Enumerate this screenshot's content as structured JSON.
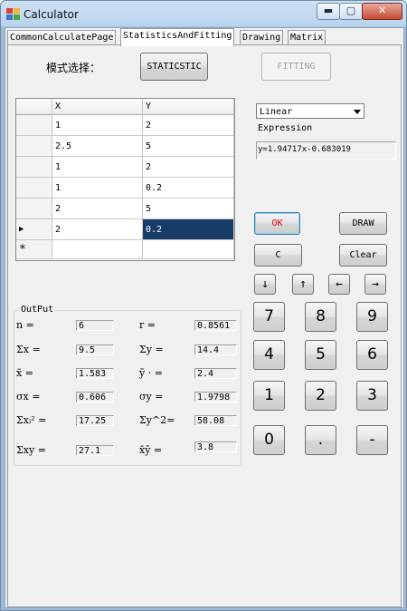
{
  "window": {
    "title": "Calculator",
    "min_glyph": "▬",
    "max_glyph": "▢",
    "close_glyph": "✕"
  },
  "tabs": [
    "CommonCalculatePage",
    "StatisticsAndFitting",
    "Drawing",
    "Matrix"
  ],
  "mode": {
    "label": "模式选择：",
    "statistic_button": "STATICSTIC",
    "fitting_button": "FITTING"
  },
  "grid": {
    "columns": [
      "X",
      "Y"
    ],
    "rows": [
      {
        "x": "1",
        "y": "2"
      },
      {
        "x": "2.5",
        "y": "5"
      },
      {
        "x": "1",
        "y": "2"
      },
      {
        "x": "1",
        "y": "0.2"
      },
      {
        "x": "2",
        "y": "5"
      },
      {
        "x": "2",
        "y": "0.2"
      }
    ],
    "current_marker": "▶",
    "new_row_marker": "*"
  },
  "fit": {
    "type": "Linear",
    "expression_label": "Expression",
    "expression": "y=1.94717x-0.683019"
  },
  "output": {
    "title": "OutPut",
    "left": [
      {
        "label": "n   =",
        "value": "6"
      },
      {
        "label": "Σx  =",
        "value": "9.5"
      },
      {
        "label": "x̄   =",
        "value": "1.583"
      },
      {
        "label": "σx  =",
        "value": "0.606"
      },
      {
        "label": "Σxᵢ² =",
        "value": "17.25"
      },
      {
        "label": "Σxy  =",
        "value": "27.1"
      }
    ],
    "right": [
      {
        "label": "r    =",
        "value": "0.8561"
      },
      {
        "label": "Σy   =",
        "value": "14.4"
      },
      {
        "label": "ȳ ·  =",
        "value": "2.4"
      },
      {
        "label": "σy   =",
        "value": "1.9798"
      },
      {
        "label": "Σy^2=",
        "value": "58.08"
      },
      {
        "label": "x̄ȳ    =",
        "value": "3.8"
      }
    ]
  },
  "controls": {
    "ok": "OK",
    "draw": "DRAW",
    "c": "C",
    "clear": "Clear",
    "arrows": [
      "↓",
      "↑",
      "←",
      "→"
    ]
  },
  "keypad": [
    "7",
    "8",
    "9",
    "4",
    "5",
    "6",
    "1",
    "2",
    "3",
    "0",
    ".",
    "-"
  ]
}
